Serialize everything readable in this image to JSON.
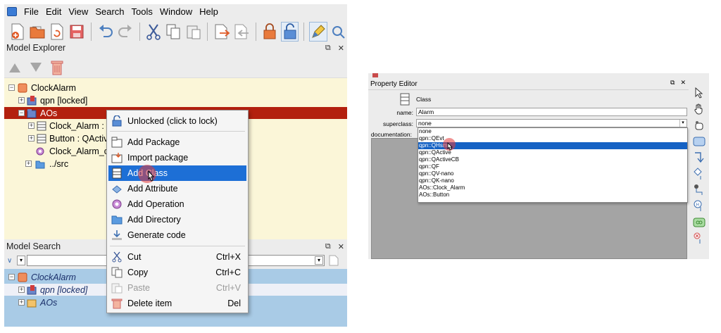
{
  "menubar": {
    "items": [
      "File",
      "Edit",
      "View",
      "Search",
      "Tools",
      "Window",
      "Help"
    ]
  },
  "model_explorer": {
    "title": "Model Explorer",
    "tree": [
      {
        "label": "ClockAlarm",
        "icon": "model-icon"
      },
      {
        "label": "qpn [locked]",
        "icon": "package-locked-icon"
      },
      {
        "label": "AOs",
        "icon": "package-icon",
        "selected": true
      },
      {
        "label": "Clock_Alarm : C",
        "icon": "class-icon"
      },
      {
        "label": "Button : QActiv",
        "icon": "class-icon"
      },
      {
        "label": "Clock_Alarm_c",
        "icon": "operation-icon"
      },
      {
        "label": "../src",
        "icon": "folder-icon"
      }
    ]
  },
  "context_menu": {
    "items": [
      {
        "label": "Unlocked (click to lock)",
        "icon": "unlock-icon",
        "shortcut": ""
      },
      {
        "label": "Add Package",
        "icon": "package-icon",
        "shortcut": ""
      },
      {
        "label": "Import package",
        "icon": "import-icon",
        "shortcut": ""
      },
      {
        "label": "Add Class",
        "icon": "class-icon",
        "shortcut": "",
        "active": true
      },
      {
        "label": "Add Attribute",
        "icon": "attribute-icon",
        "shortcut": ""
      },
      {
        "label": "Add Operation",
        "icon": "operation-icon",
        "shortcut": ""
      },
      {
        "label": "Add Directory",
        "icon": "folder-icon",
        "shortcut": ""
      },
      {
        "label": "Generate code",
        "icon": "generate-icon",
        "shortcut": ""
      },
      {
        "label": "Cut",
        "icon": "scissors-icon",
        "shortcut": "Ctrl+X"
      },
      {
        "label": "Copy",
        "icon": "copy-icon",
        "shortcut": "Ctrl+C"
      },
      {
        "label": "Paste",
        "icon": "paste-icon",
        "shortcut": "Ctrl+V",
        "disabled": true
      },
      {
        "label": "Delete item",
        "icon": "trash-icon",
        "shortcut": "Del"
      }
    ]
  },
  "model_search": {
    "title": "Model Search",
    "tree": [
      {
        "label": "ClockAlarm"
      },
      {
        "label": "qpn [locked]"
      },
      {
        "label": "AOs"
      }
    ]
  },
  "property_editor": {
    "title": "Property Editor",
    "kind": "Class",
    "name_label": "name:",
    "name_value": "Alarm",
    "superclass_label": "superclass:",
    "superclass_value": "none",
    "documentation_label": "documentation:",
    "superclass_options": [
      "none",
      "qpn::QEvt",
      "qpn::QHsm",
      "qpn::QActive",
      "qpn::QActiveCB",
      "qpn::QF",
      "qpn::QV-nano",
      "qpn::QK-nano",
      "AOs::Clock_Alarm",
      "AOs::Button"
    ],
    "highlighted_option": "qpn::QHsm"
  },
  "colors": {
    "tree_bg": "#fbf6d8",
    "selected_row": "#b3200e",
    "menu_highlight": "#1d6fd6",
    "search_bg": "#a9cbe6"
  }
}
